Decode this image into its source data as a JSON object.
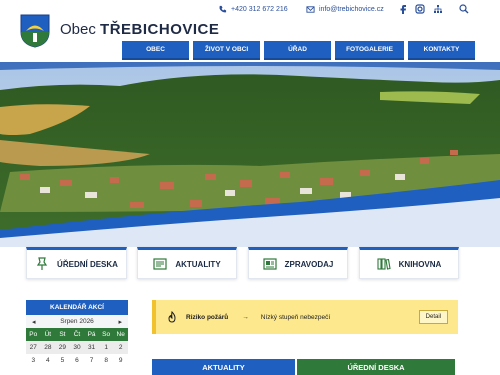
{
  "header": {
    "title_prefix": "Obec",
    "title_name": "TŘEBICHOVICE",
    "phone": "+420 312 672 216",
    "email": "info@trebichovice.cz"
  },
  "nav": [
    {
      "label": "OBEC"
    },
    {
      "label": "ŽIVOT V OBCI"
    },
    {
      "label": "ÚŘAD"
    },
    {
      "label": "FOTOGALERIE"
    },
    {
      "label": "KONTAKTY"
    }
  ],
  "tiles": [
    {
      "label": "ÚŘEDNÍ DESKA",
      "icon": "pin-icon"
    },
    {
      "label": "AKTUALITY",
      "icon": "news-icon"
    },
    {
      "label": "ZPRAVODAJ",
      "icon": "newspaper-icon"
    },
    {
      "label": "KNIHOVNA",
      "icon": "books-icon"
    }
  ],
  "calendar": {
    "title": "KALENDÁŘ AKCÍ",
    "month": "Srpen 2026",
    "days": [
      "Po",
      "Út",
      "St",
      "Čt",
      "Pá",
      "So",
      "Ne"
    ],
    "rows": [
      [
        "27",
        "28",
        "29",
        "30",
        "31",
        "1",
        "2"
      ],
      [
        "3",
        "4",
        "5",
        "6",
        "7",
        "8",
        "9"
      ]
    ]
  },
  "fire": {
    "label": "Riziko požárů",
    "arrow": "→",
    "level_text": "Nízký stupeň nebezpečí",
    "button": "Detail"
  },
  "tabs": [
    {
      "label": "AKTUALITY",
      "color": "#1f5fbf"
    },
    {
      "label": "ÚŘEDNÍ DESKA",
      "color": "#2f7a3a"
    }
  ],
  "colors": {
    "brand_blue": "#1f5fbf",
    "brand_green": "#2f7a3a",
    "warning_yellow": "#fde88d"
  }
}
